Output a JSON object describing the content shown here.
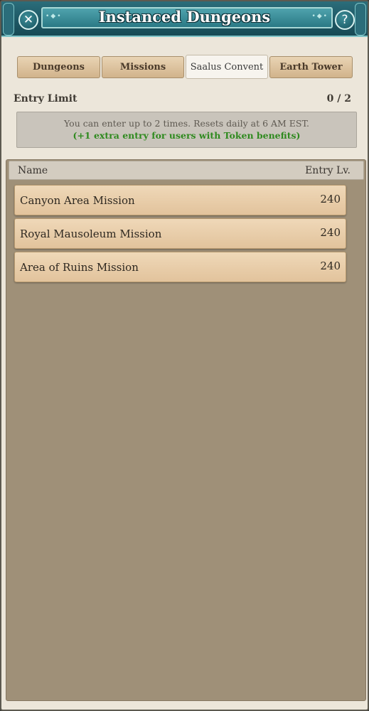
{
  "window": {
    "title": "Instanced Dungeons",
    "close_icon": "close-icon",
    "help_icon": "question-mark-icon",
    "help_label": "?"
  },
  "tabs": [
    {
      "label": "Dungeons",
      "active": false
    },
    {
      "label": "Missions",
      "active": false
    },
    {
      "label": "Saalus Convent",
      "active": true
    },
    {
      "label": "Earth Tower",
      "active": false
    }
  ],
  "entry_limit": {
    "label": "Entry Limit",
    "count": "0 / 2",
    "info_line1": "You can enter up to 2 times. Resets daily at 6 AM EST.",
    "info_line2": "(+1 extra entry for users with Token benefits)"
  },
  "list": {
    "columns": {
      "name": "Name",
      "level": "Entry Lv."
    },
    "rows": [
      {
        "name": "Canyon Area Mission",
        "level": "240"
      },
      {
        "name": "Royal Mausoleum Mission",
        "level": "240"
      },
      {
        "name": "Area of Ruins Mission",
        "level": "240"
      }
    ]
  },
  "colors": {
    "title_bar": "#1f5a67",
    "panel_bg": "#9f9078",
    "row_bg": "#e2c39c",
    "bonus_text": "#2f8a1f"
  }
}
